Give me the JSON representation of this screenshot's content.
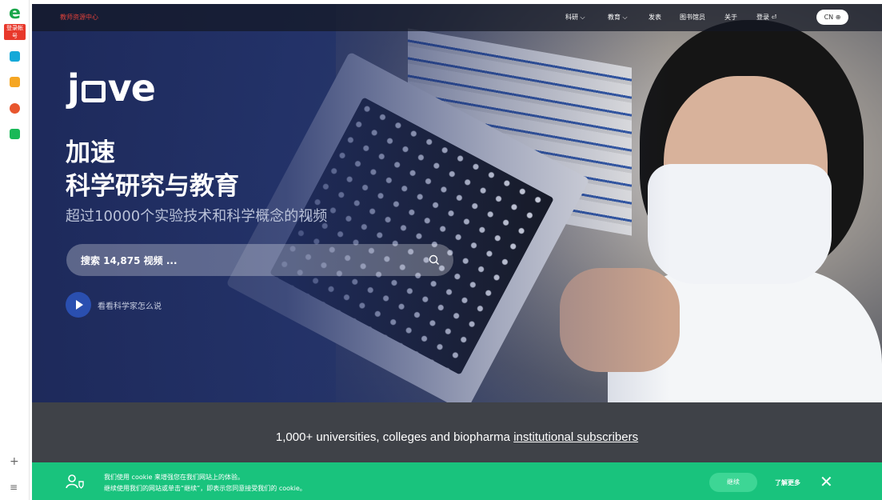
{
  "rail": {
    "logo_letter": "e",
    "badge": "登录帐号",
    "apps": [
      {
        "icon": "plus-grid-icon",
        "color": "#15a8d8"
      },
      {
        "icon": "star-icon",
        "color": "#f5a623"
      },
      {
        "icon": "weibo-icon",
        "color": "#e8562e"
      },
      {
        "icon": "mail-icon",
        "color": "#19b957"
      }
    ],
    "add": "+",
    "menu": "≡"
  },
  "nav": {
    "brand_link": "教师资源中心",
    "items": [
      "科研 ⌵",
      "教育 ⌵",
      "发表",
      "图书馆员",
      "关于",
      "登录 ⏎"
    ],
    "lang": "CN ⊕"
  },
  "hero": {
    "logo_left": "j",
    "logo_right": "ve",
    "headline_line1": "加速",
    "headline_line2": "科学研究与教育",
    "subhead": "超过10000个实验技术和科学概念的视频",
    "search_placeholder": "搜索 14,875 视频 ...",
    "watch_text": "看看科学家怎么说"
  },
  "band": {
    "text": "1,000+ universities, colleges and biopharma ",
    "link": "institutional subscribers"
  },
  "cookie": {
    "line1": "我们使用 cookie 来增强您在我们网站上的体验。",
    "line2": "继续使用我们的网站或单击“继续”，即表示您同意接受我们的 cookie。",
    "continue": "继续",
    "learn_more": "了解更多",
    "close": "✕"
  },
  "colors": {
    "accent_green": "#19c37d",
    "brand_red": "#e0413a",
    "hero_blue": "#2a4fb0"
  }
}
